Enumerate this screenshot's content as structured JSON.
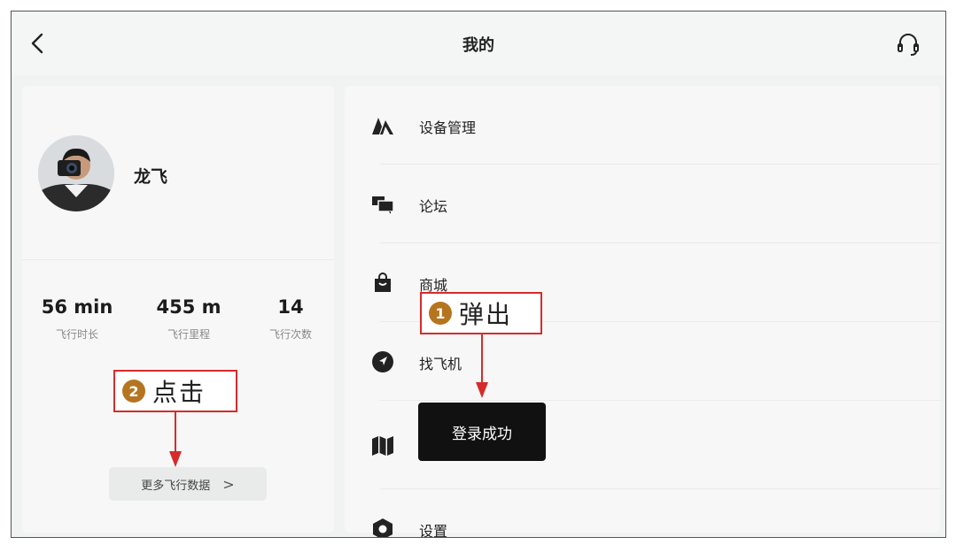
{
  "header": {
    "title": "我的",
    "back_icon": "chevron-left-icon",
    "support_icon": "headset-icon"
  },
  "profile": {
    "name": "龙飞",
    "avatar_icon": "avatar-photo"
  },
  "stats": [
    {
      "value": "56 min",
      "label": "飞行时长"
    },
    {
      "value": "455 m",
      "label": "飞行里程"
    },
    {
      "value": "14",
      "label": "飞行次数"
    }
  ],
  "more_button": {
    "label": "更多飞行数据",
    "chevron": ">"
  },
  "menu": [
    {
      "label": "设备管理",
      "icon": "drone-logo-icon"
    },
    {
      "label": "论坛",
      "icon": "chat-bubbles-icon"
    },
    {
      "label": "商城",
      "icon": "shopping-bag-icon"
    },
    {
      "label": "找飞机",
      "icon": "locate-arrow-icon"
    },
    {
      "label": "",
      "icon": "map-icon"
    },
    {
      "label": "设置",
      "icon": "settings-hexagon-icon"
    }
  ],
  "toast": {
    "text": "登录成功"
  },
  "annotations": [
    {
      "number": "1",
      "text": "弹出"
    },
    {
      "number": "2",
      "text": "点击"
    }
  ],
  "colors": {
    "annotation_border": "#d62b2b",
    "annotation_badge": "#b5751f",
    "toast_bg": "#111111"
  }
}
